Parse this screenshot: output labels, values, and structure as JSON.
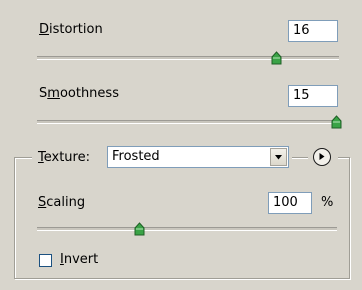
{
  "distortion": {
    "label_pre": "",
    "label_ul": "D",
    "label_post": "istortion",
    "value": "16",
    "slider_fraction": 0.8
  },
  "smoothness": {
    "label_pre": "S",
    "label_ul": "m",
    "label_post": "oothness",
    "value": "15",
    "slider_fraction": 1.0
  },
  "texture": {
    "label_pre": "",
    "label_ul": "T",
    "label_post": "exture:",
    "selected": "Frosted"
  },
  "scaling": {
    "label_pre": "",
    "label_ul": "S",
    "label_post": "caling",
    "value": "100",
    "unit": "%",
    "slider_fraction": 0.36
  },
  "invert": {
    "label_pre": "",
    "label_ul": "I",
    "label_post": "nvert",
    "checked": false
  },
  "colors": {
    "background": "#d8d5cc",
    "thumb_green": "#3aa346"
  }
}
